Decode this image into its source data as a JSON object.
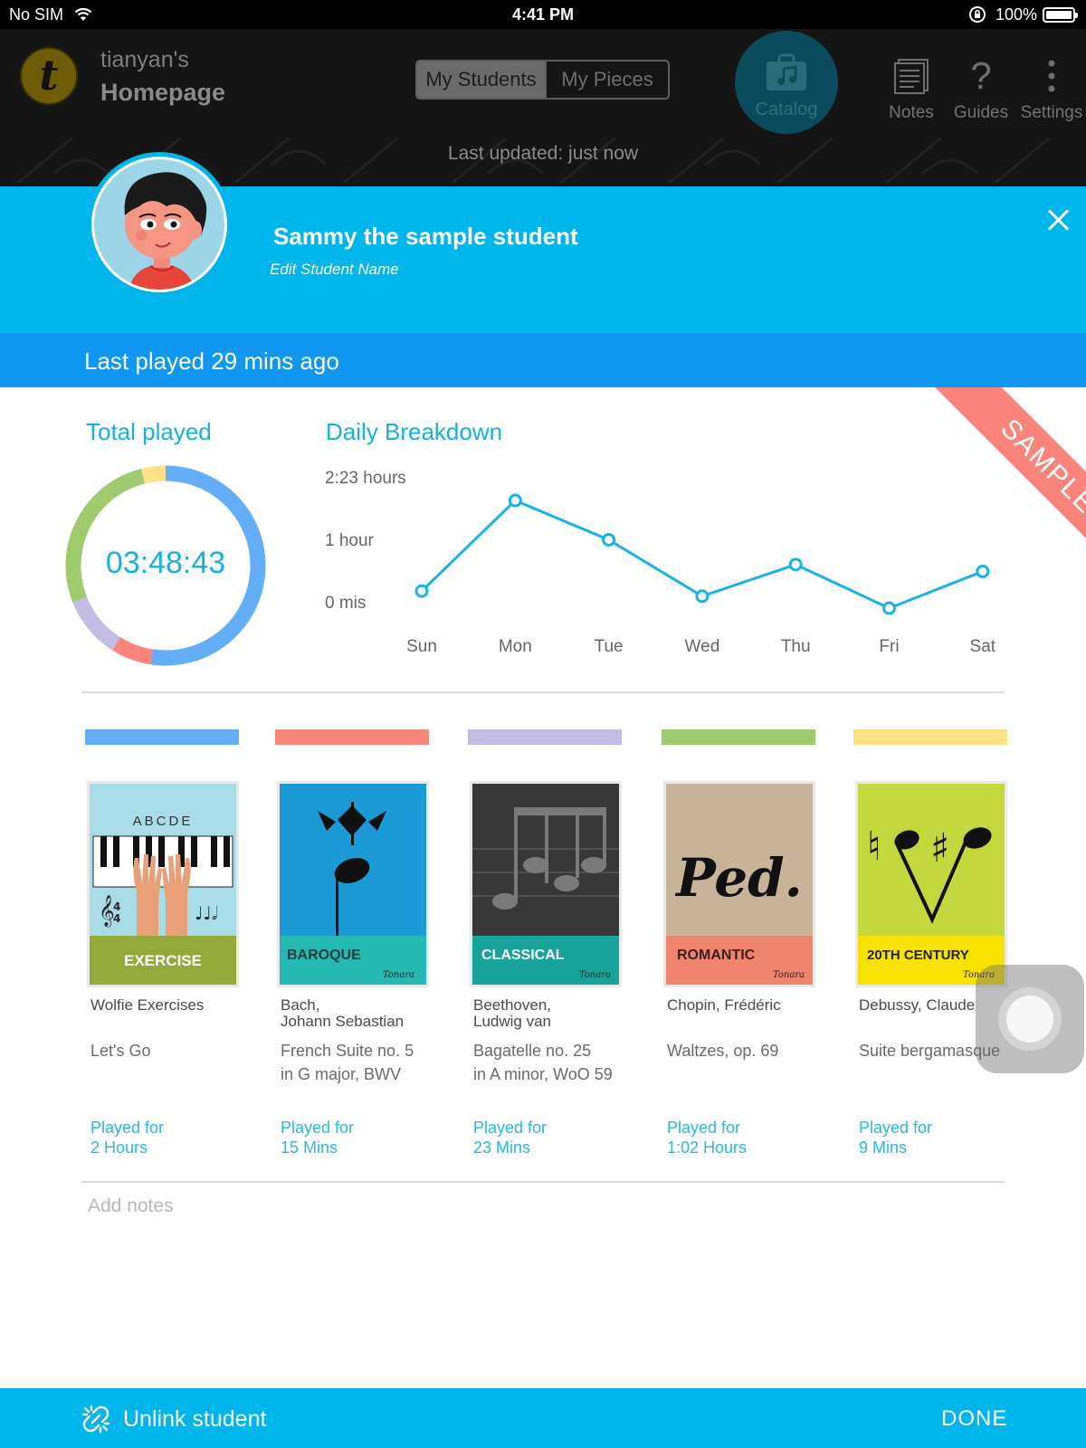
{
  "status_bar": {
    "carrier": "No SIM",
    "time": "4:41 PM",
    "battery": "100%"
  },
  "header": {
    "owner": "tianyan's",
    "title": "Homepage",
    "segmented": {
      "students": "My Students",
      "pieces": "My Pieces"
    },
    "catalog": "Catalog",
    "notes": "Notes",
    "guides": "Guides",
    "settings": "Settings",
    "last_updated": "Last updated: just now",
    "logo_letter": "t"
  },
  "student": {
    "name": "Sammy the sample student",
    "edit_label": "Edit Student Name",
    "last_played": "Last played 29 mins ago",
    "sample_badge": "SAMPLE"
  },
  "total_played": {
    "title": "Total played",
    "time": "03:48:43"
  },
  "chart_data": [
    {
      "type": "line",
      "title": "Daily Breakdown",
      "categories": [
        "Sun",
        "Mon",
        "Tue",
        "Wed",
        "Thu",
        "Fri",
        "Sat"
      ],
      "y_tick_labels": [
        "0 mis",
        "1 hour",
        "2:23 hours"
      ],
      "ylim": [
        0,
        143
      ],
      "series": [
        {
          "values": [
            20,
            126,
            80,
            14,
            51,
            0,
            43
          ]
        }
      ],
      "color": "#18b2ea",
      "grid": false
    },
    {
      "type": "pie",
      "title": "Total played",
      "categories": [
        "Wolfie Exercises",
        "Bach",
        "Beethoven",
        "Chopin",
        "Debussy"
      ],
      "values": [
        120,
        15,
        23,
        62,
        9
      ],
      "colors": [
        "#64adf7",
        "#fa857d",
        "#c3bde5",
        "#9fcb6e",
        "#fde187"
      ]
    }
  ],
  "pieces": [
    {
      "color": "#64adf7",
      "cover_label": "EXERCISE",
      "composer": "Wolfie Exercises",
      "title": "Let's Go",
      "played_label": "Played for",
      "played_value": "2 Hours",
      "letters": "ABCDE"
    },
    {
      "color": "#fa857d",
      "cover_label": "BAROQUE",
      "composer": "Bach,\nJohann Sebastian",
      "title": "French Suite no. 5\nin G major, BWV",
      "played_label": "Played for",
      "played_value": "15 Mins"
    },
    {
      "color": "#c3bde5",
      "cover_label": "CLASSICAL",
      "composer": "Beethoven,\nLudwig van",
      "title": "Bagatelle no. 25\nin A minor, WoO 59",
      "played_label": "Played for",
      "played_value": "23 Mins"
    },
    {
      "color": "#9fcb6e",
      "cover_label": "ROMANTIC",
      "composer": "Chopin, Frédéric",
      "title": "Waltzes, op. 69",
      "played_label": "Played for",
      "played_value": "1:02 Hours",
      "cover_text": "Ped."
    },
    {
      "color": "#fde187",
      "cover_label": "20TH CENTURY",
      "composer": "Debussy,  Claude",
      "title": "Suite bergamasque",
      "played_label": "Played for",
      "played_value": "9 Mins"
    }
  ],
  "cover_brand": "Tonara",
  "notes_placeholder": "Add notes",
  "footer": {
    "unlink": "Unlink student",
    "done": "DONE"
  }
}
